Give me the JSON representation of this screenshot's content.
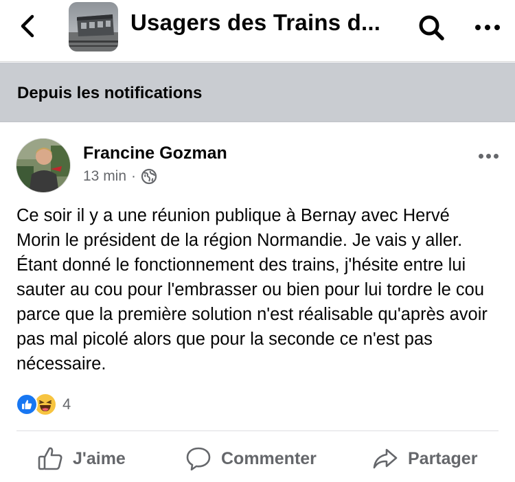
{
  "header": {
    "back_icon": "chevron-left-icon",
    "group_title": "Usagers des Trains d...",
    "search_icon": "search-icon",
    "more_icon": "more-horizontal-icon"
  },
  "notification_banner": {
    "label": "Depuis les notifications"
  },
  "post": {
    "author": "Francine Gozman",
    "time": "13 min",
    "separator": "·",
    "privacy_icon": "globe-icon",
    "text": "Ce soir il y a une réunion publique à  Bernay avec Hervé Morin le président de la région Normandie. Je vais y aller. Étant donné le fonctionnement des trains, j'hésite entre lui sauter au cou pour l'embrasser ou bien pour lui tordre le cou parce que la première solution n'est réalisable qu'après avoir pas mal picolé alors que pour la seconde ce n'est pas nécessaire.",
    "reactions": {
      "types": [
        "like",
        "haha"
      ],
      "count": "4"
    }
  },
  "actions": {
    "like_label": "J'aime",
    "comment_label": "Commenter",
    "share_label": "Partager"
  },
  "colors": {
    "banner_bg": "#c9ccd1",
    "secondary_text": "#65676b",
    "like_blue": "#1877f2",
    "haha_yellow": "#f7c440"
  }
}
